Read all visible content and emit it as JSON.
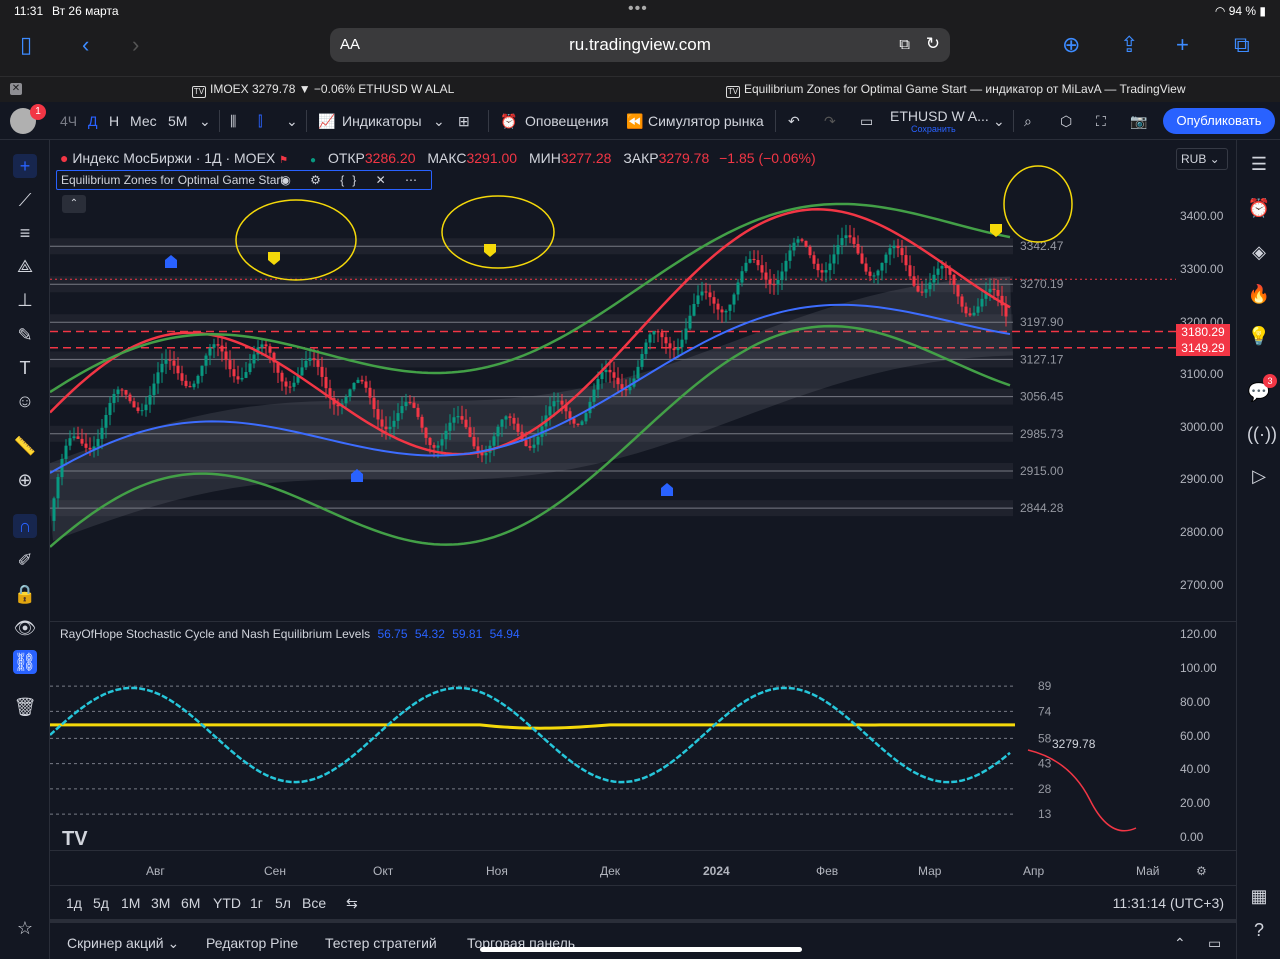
{
  "status": {
    "time": "11:31",
    "date": "Вт 26 марта",
    "battery": "94 %"
  },
  "browser": {
    "aa": "AA",
    "url": "ru.tradingview.com",
    "tabs": [
      {
        "title": "IMOEX 3279.78 ▼ −0.06% ETHUSD W ALAL"
      },
      {
        "title": "Equilibrium Zones for Optimal Game Start — индикатор от MiLavA — TradingView"
      }
    ]
  },
  "toolbar": {
    "avatar_badge": "1",
    "intervals": [
      "4Ч",
      "Д",
      "Н",
      "Мес",
      "5М"
    ],
    "indicators": "Индикаторы",
    "alerts": "Оповещения",
    "replay": "Симулятор рынка",
    "layout_name": "ETHUSD W A...",
    "save": "Сохранить",
    "publish": "Опубликовать"
  },
  "legend": {
    "symbol": "Индекс МосБиржи · 1Д · MOEX",
    "open_label": "ОТКР",
    "open": "3286.20",
    "high_label": "МАКС",
    "high": "3291.00",
    "low_label": "МИН",
    "low": "3277.28",
    "close_label": "ЗАКР",
    "close": "3279.78",
    "change": "−1.85 (−0.06%)",
    "currency": "RUB"
  },
  "indicator1": {
    "name": "Equilibrium Zones for Optimal Game Start",
    "icons": "◉ ⚙ {} ✕ ⋯"
  },
  "indicator2": {
    "name": "RayOfHope Stochastic Cycle and Nash Equilibrium Levels",
    "values": [
      "56.75",
      "54.32",
      "59.81",
      "54.94"
    ]
  },
  "price_axis": [
    "3400.00",
    "3300.00",
    "3200.00",
    "3100.00",
    "3000.00",
    "2900.00",
    "2800.00",
    "2700.00"
  ],
  "level_labels": [
    "3342.47",
    "3270.19",
    "3197.90",
    "3127.17",
    "3056.45",
    "2985.73",
    "2915.00",
    "2844.28"
  ],
  "price_tags": [
    "3180.29",
    "3149.29"
  ],
  "osc_axis": [
    "120.00",
    "100.00",
    "80.00",
    "60.00",
    "40.00",
    "20.00",
    "0.00"
  ],
  "osc_levels": [
    "89",
    "74",
    "58",
    "43",
    "28",
    "13"
  ],
  "osc_price": "3279.78",
  "time_axis": [
    "Авг",
    "Сен",
    "Окт",
    "Ноя",
    "Дек",
    "2024",
    "Фев",
    "Мар",
    "Апр",
    "Май"
  ],
  "ranges": [
    "1д",
    "5д",
    "1М",
    "3М",
    "6М",
    "YTD",
    "1г",
    "5л",
    "Все"
  ],
  "clock": "11:31:14 (UTC+3)",
  "bottom_tabs": [
    "Скринер акций",
    "Редактор Pine",
    "Тестер стратегий",
    "Торговая панель"
  ],
  "colors": {
    "bg": "#131722",
    "up": "#089981",
    "down": "#f23645",
    "accent": "#2962ff",
    "annot": "#f5d90a"
  }
}
